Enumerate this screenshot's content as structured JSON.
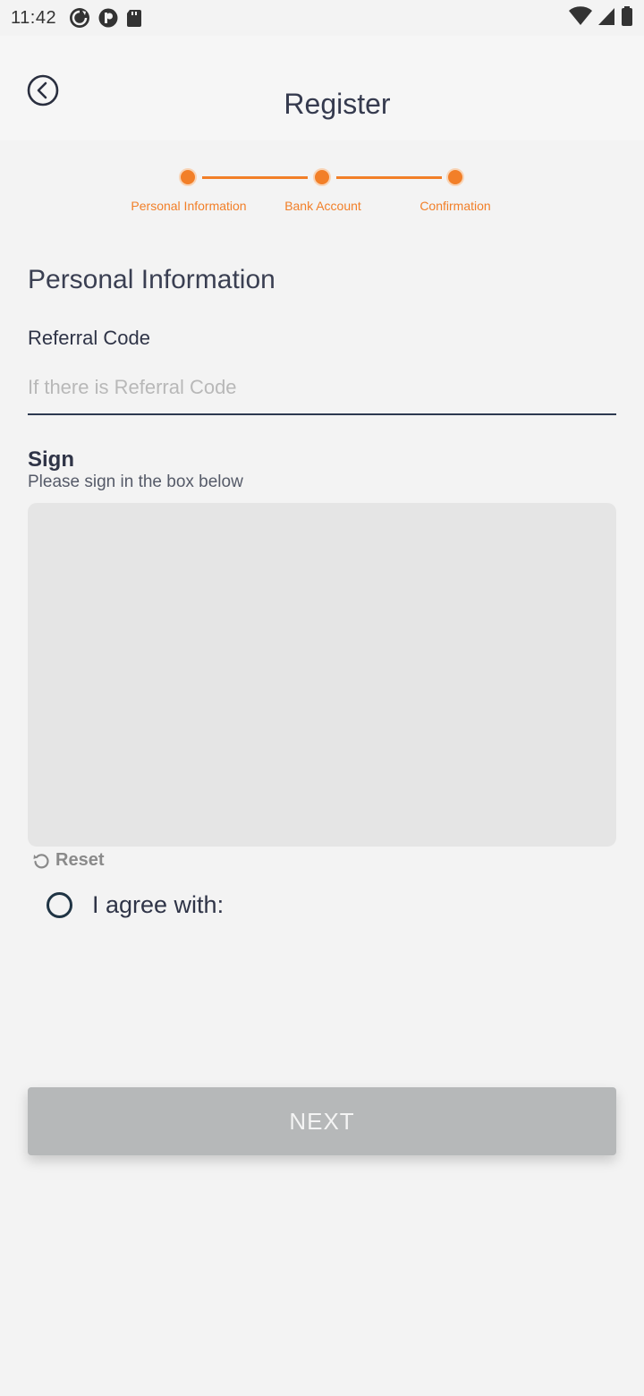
{
  "status_bar": {
    "time": "11:42",
    "left_icons": [
      "sync-icon",
      "p-icon",
      "sd-card-icon"
    ],
    "right_icons": [
      "wifi-icon",
      "signal-icon",
      "battery-icon"
    ]
  },
  "header": {
    "title": "Register",
    "back_icon": "chevron-left-circle-icon"
  },
  "stepper": {
    "steps": [
      {
        "label": "Personal Information"
      },
      {
        "label": "Bank Account"
      },
      {
        "label": "Confirmation"
      }
    ],
    "accent_color": "#f27f28"
  },
  "form": {
    "section_title": "Personal Information",
    "referral": {
      "label": "Referral Code",
      "value": "",
      "placeholder": "If there is Referral Code"
    },
    "sign": {
      "label": "Sign",
      "help": "Please sign in the box below",
      "reset_label": "Reset"
    },
    "agree": {
      "label": "I agree with:",
      "checked": false
    },
    "next_label": "NEXT"
  }
}
